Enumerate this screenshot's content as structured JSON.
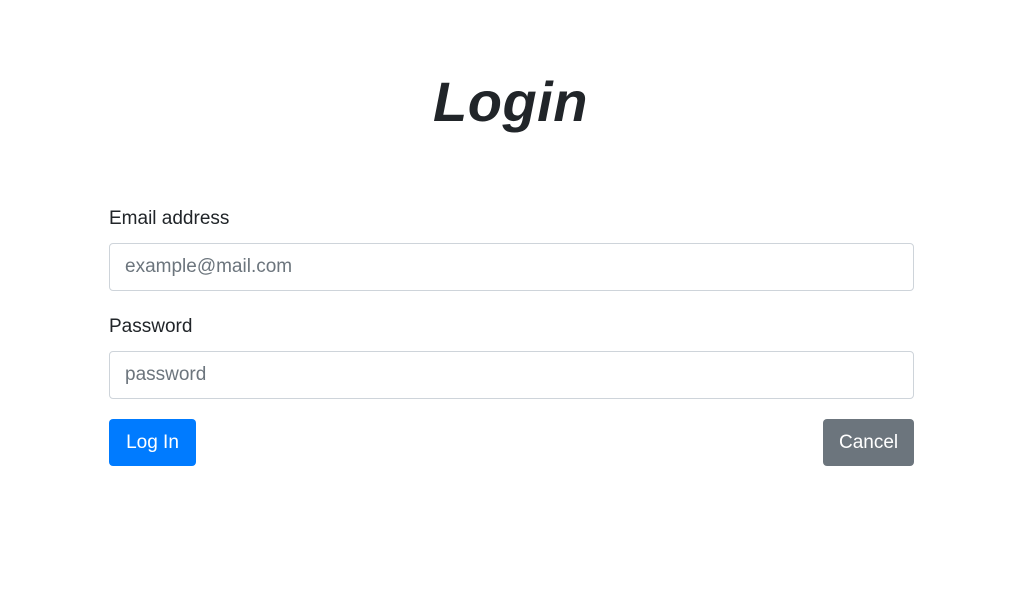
{
  "page": {
    "title": "Login"
  },
  "form": {
    "email": {
      "label": "Email address",
      "placeholder": "example@mail.com",
      "value": ""
    },
    "password": {
      "label": "Password",
      "placeholder": "password",
      "value": ""
    },
    "login_button_label": "Log In",
    "cancel_button_label": "Cancel"
  },
  "colors": {
    "primary": "#007bff",
    "secondary": "#6c757d",
    "text": "#212529",
    "input_border": "#ced4da",
    "background": "#ffffff"
  }
}
